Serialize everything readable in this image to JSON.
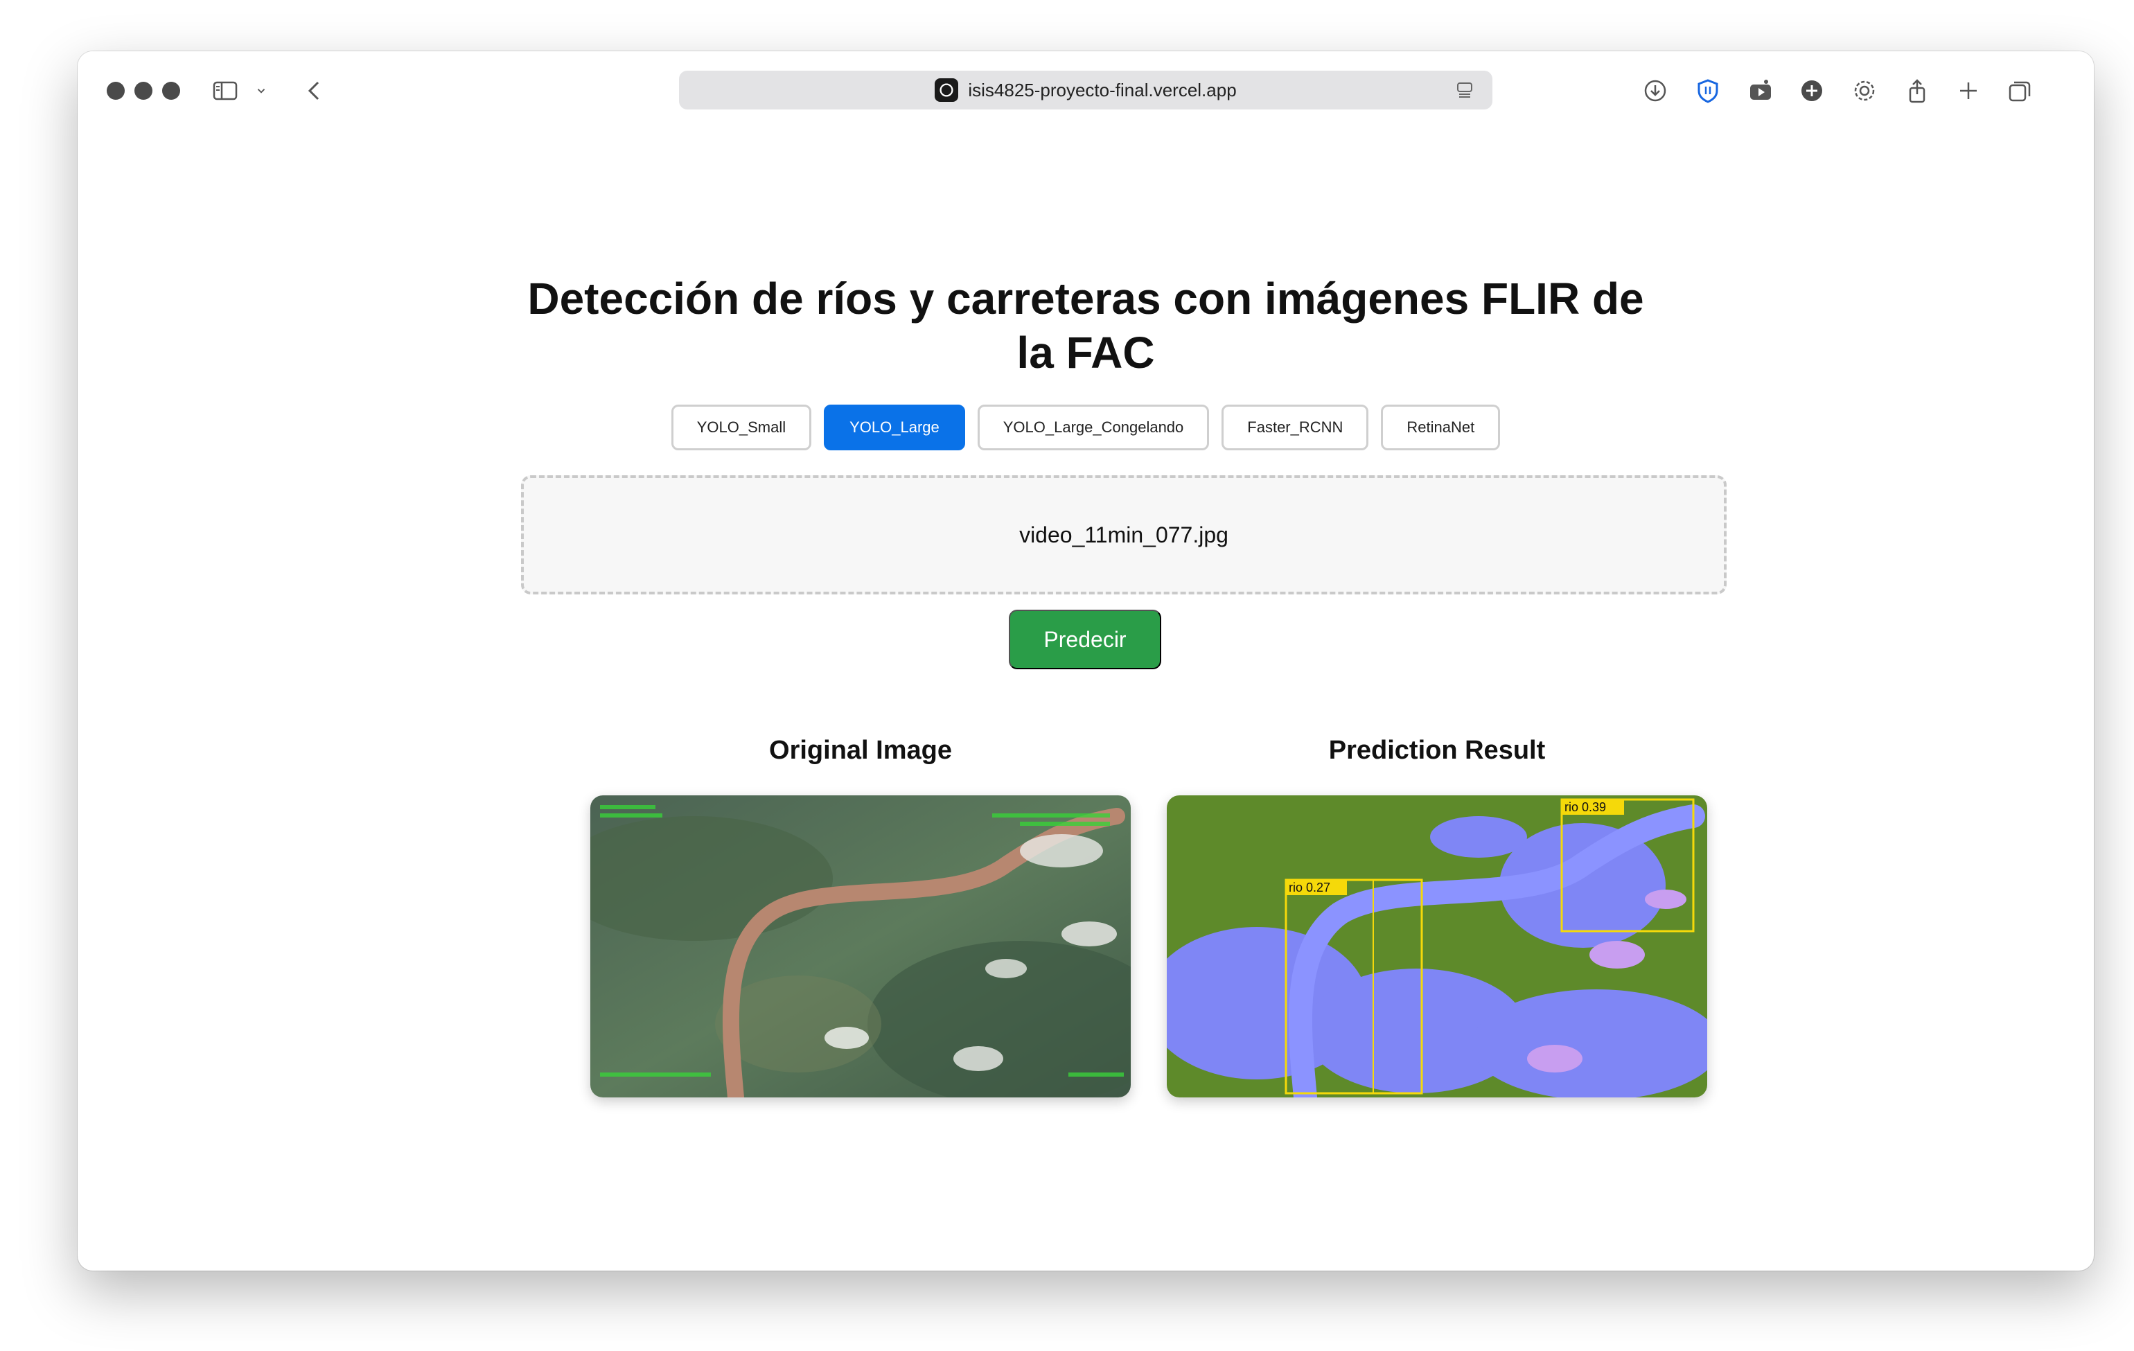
{
  "browser": {
    "url": "isis4825-proyecto-final.vercel.app"
  },
  "page": {
    "title": "Detección de ríos y carreteras con imágenes FLIR de la FAC",
    "models": [
      "YOLO_Small",
      "YOLO_Large",
      "YOLO_Large_Congelando",
      "Faster_RCNN",
      "RetinaNet"
    ],
    "selected_model": "YOLO_Large",
    "file_name": "video_11min_077.jpg",
    "predict_label": "Predecir",
    "original_title": "Original Image",
    "prediction_title": "Prediction Result",
    "detections": [
      {
        "label": "rio 0.39"
      },
      {
        "label": "rio 0.27"
      }
    ]
  },
  "colors": {
    "primary": "#0a72e8",
    "success": "#2a9d48",
    "detection_box": "#f5d90a"
  }
}
